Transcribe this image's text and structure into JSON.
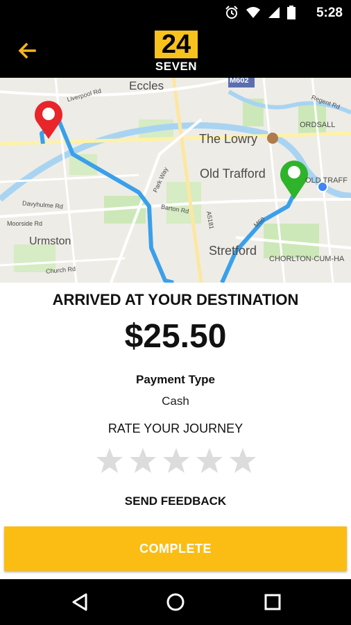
{
  "status_bar": {
    "time": "5:28",
    "icons": [
      "alarm-icon",
      "wifi-icon",
      "signal-icon",
      "battery-icon"
    ]
  },
  "app_bar": {
    "back_icon": "arrow-back-icon",
    "logo_number": "24",
    "logo_text": "SEVEN"
  },
  "map": {
    "labels": {
      "eccles": "Eccles",
      "m602": "M602",
      "liverpool_rd": "Liverpool Rd",
      "regent_rd": "Regent Rd",
      "ordsall": "ORDSALL",
      "the_lowry": "The Lowry",
      "old_trafford": "Old Trafford",
      "old_traff": "OLD TRAFF",
      "park_way": "Park Way",
      "barton_rd": "Barton Rd",
      "a5181": "A5181",
      "davyhulme_rd": "Davyhulme Rd",
      "moorside_rd": "Moorside Rd",
      "urmston": "Urmston",
      "church_rd": "Church Rd",
      "stretford": "Stretford",
      "m60": "M60",
      "chorlton": "CHORLTON-CUM-HA"
    }
  },
  "trip": {
    "title": "ARRIVED AT YOUR DESTINATION",
    "fare": "$25.50",
    "payment_type_label": "Payment Type",
    "payment_type_value": "Cash",
    "rate_label": "RATE YOUR JOURNEY",
    "rating": 0,
    "rating_max": 5,
    "feedback_label": "SEND FEEDBACK",
    "complete_label": "COMPLETE"
  },
  "colors": {
    "accent": "#fbbd14",
    "route": "#4aa8ee",
    "start_pin": "#e8252b",
    "end_pin": "#2fb32a"
  },
  "nav_bar": {
    "icons": [
      "back-triangle-icon",
      "home-circle-icon",
      "recents-square-icon"
    ]
  }
}
